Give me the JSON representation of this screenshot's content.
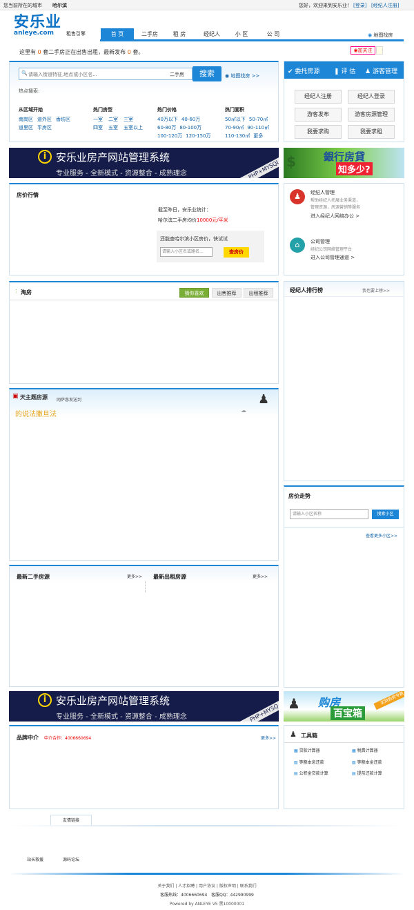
{
  "topbar": {
    "city_prefix": "您当前所在的城市",
    "city": "哈尔滨",
    "greeting": "您好，欢迎来到安乐业！",
    "login": "[登录]",
    "register": "[经纪人注册]"
  },
  "logo": {
    "cn": "安乐业",
    "en": "anleye.com",
    "tagline": "租售引擎"
  },
  "nav": [
    "首 页",
    "二手房",
    "租 房",
    "经纪人",
    "小 区",
    "公 司"
  ],
  "nav_map": "地图找房",
  "stats": {
    "prefix": "这里有",
    "count1": "0",
    "mid": "套二手房正在出售出租，最新发布",
    "count2": "0",
    "suffix": "套。"
  },
  "follow": "加关注",
  "search": {
    "placeholder": "请输入街道特征,地点或小区名...",
    "type": "二手房",
    "button": "搜索",
    "map": "地图找房 >>",
    "hot": "热点搜索:"
  },
  "filters": {
    "area": {
      "title": "从区域开始",
      "items": [
        "南岗区",
        "道外区",
        "香坊区",
        "道里区",
        "平房区"
      ]
    },
    "type": {
      "title": "热门房型",
      "items": [
        "一室",
        "二室",
        "三室",
        "四室",
        "五室",
        "五室以上"
      ]
    },
    "price": {
      "title": "热门价格",
      "items": [
        "40万以下",
        "40-60万",
        "60-80万",
        "80-100万",
        "100-120万",
        "120-150万"
      ]
    },
    "size": {
      "title": "热门面积",
      "items": [
        "50㎡以下",
        "50-70㎡",
        "70-90㎡",
        "90-110㎡",
        "110-130㎡",
        "更多"
      ]
    }
  },
  "service": {
    "tabs": [
      "委托房源",
      "评 估",
      "游客管理"
    ],
    "buttons": [
      "经纪人注册",
      "经纪人登录",
      "游客发布",
      "游客房源管理",
      "我要求购",
      "我要求租"
    ]
  },
  "banner1": {
    "title": "安乐业房产网站管理系统",
    "sub": "专业服务 - 全新模式 - 资源整合 - 成熟理念",
    "tag": "PHP+MYSQL"
  },
  "ad1": {
    "t1": "銀行房貸",
    "t2": "知多少?"
  },
  "price_market": {
    "title": "房价行情",
    "line1": "截至昨日，安乐业统计：",
    "line2a": "哈尔滨二手房均价",
    "price": "10000元/平米",
    "check": "还能查哈尔滨小区房价，快试试",
    "placeholder": "请输入小区名或路名...",
    "button": "查房价"
  },
  "agent_mgmt": {
    "title": "经纪人管理",
    "desc1": "帮助经纪人托展业务渠道，",
    "desc2": "管理资源，房源营销等服务",
    "link": "进入经纪人网络办公 >"
  },
  "company_mgmt": {
    "title": "公司管理",
    "desc": "经纪公司网络管理平台",
    "link": "进入公司管理通道 >"
  },
  "taofang": {
    "title": "淘房",
    "tabs": [
      "猜你喜欢",
      "出售推荐",
      "出租推荐"
    ]
  },
  "ranking": {
    "title": "经纪人排行榜",
    "link": "我也要上榜>>"
  },
  "topic": {
    "brand": "天主题房源",
    "sub": "网萨惠发送到",
    "slogan": "的说法撒旦法"
  },
  "trend": {
    "title": "房价走势",
    "placeholder": "请输入小区名称",
    "button": "搜索小区",
    "more": "查看更多小区>>"
  },
  "latest": {
    "sale": "最新二手房源",
    "rent": "最新出租房源",
    "more": "更多>>"
  },
  "banner2": {
    "title": "安乐业房产网站管理系统",
    "sub": "专业服务 - 全新模式 - 资源整合 - 成熟理念",
    "tag": "PHP+MYSQ"
  },
  "ad2": {
    "t1": "购房",
    "t2": "百宝箱",
    "tag": "实用购房专题"
  },
  "brand": {
    "title": "品牌中介",
    "coop": "中介合作：",
    "phone": "4006660694",
    "more": "更多>>"
  },
  "tools": {
    "title": "工具箱",
    "items": [
      "贷款计算器",
      "税费计算器",
      "等额本息还款",
      "等额本金还款",
      "公积金贷款计算",
      "提前还款计算"
    ]
  },
  "links": {
    "tab": "友情链接",
    "items": [
      "站长救援",
      "源码论坛"
    ]
  },
  "footer": {
    "links": "关于我们 | 人才招聘 | 用户协议 | 版权声明 | 联系我们",
    "hotline_label": "客服热线：",
    "hotline": "4006660694",
    "qq_label": "客服QQ：",
    "qq": "442990999",
    "powered": "Powered by ANLEYE V5 黑10000001"
  }
}
